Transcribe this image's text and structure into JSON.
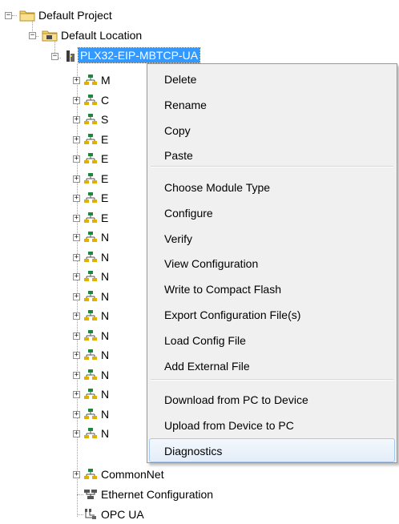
{
  "tree": {
    "root_label": "Default Project",
    "location_label": "Default Location",
    "module_label": "PLX32-EIP-MBTCP-UA",
    "child_initials": [
      "M",
      "C",
      "S",
      "E",
      "E",
      "E",
      "E",
      "E",
      "N",
      "N",
      "N",
      "N",
      "N",
      "N",
      "N",
      "N",
      "N",
      "N",
      "N"
    ],
    "commonnet_label": "CommonNet",
    "ethernet_label": "Ethernet Configuration",
    "opcua_label": "OPC UA"
  },
  "context_menu": {
    "group1": [
      "Delete",
      "Rename",
      "Copy",
      "Paste"
    ],
    "group2": [
      "Choose Module Type",
      "Configure",
      "Verify",
      "View Configuration",
      "Write to Compact Flash",
      "Export Configuration File(s)",
      "Load Config File",
      "Add External File"
    ],
    "group3": [
      "Download from PC to Device",
      "Upload from Device to PC",
      "Diagnostics"
    ],
    "highlighted_item": "Diagnostics"
  },
  "colors": {
    "selection": "#3399ff",
    "menu_bg": "#f0f0f0",
    "folder": "#f5d36a",
    "network_icon": "#1a8a3a"
  }
}
